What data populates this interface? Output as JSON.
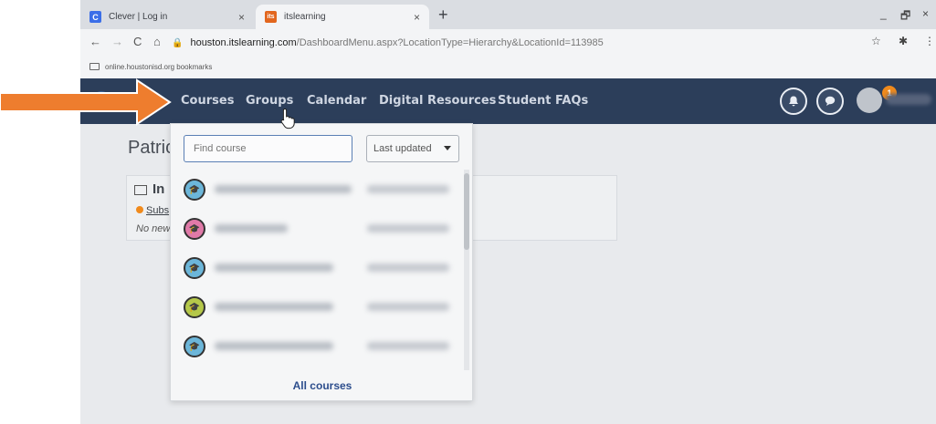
{
  "browser": {
    "tabs": [
      {
        "favicon": "C",
        "title": "Clever | Log in",
        "close": "×"
      },
      {
        "favicon": "its",
        "title": "itslearning",
        "close": "×"
      }
    ],
    "new_tab": "+",
    "window_controls": {
      "minimize": "_",
      "restore": "🗗",
      "close": "×"
    },
    "nav": {
      "back": "←",
      "forward": "→",
      "reload": "C",
      "home": "⌂"
    },
    "address": {
      "host": "houston.itslearning.com",
      "path": "/DashboardMenu.aspx?LocationType=Hierarchy&LocationId=113985"
    },
    "toolbar_icons": {
      "star": "☆",
      "extensions": "✱",
      "menu": "⋮"
    },
    "bookmarks_bar": {
      "folder": "online.houstonisd.org bookmarks"
    }
  },
  "itslearning_nav": {
    "links": [
      "Courses",
      "Groups",
      "Calendar",
      "Digital Resources",
      "Student FAQs"
    ],
    "notifications_count": "1",
    "bell_icon": "🔔",
    "messages_icon": "💬"
  },
  "page": {
    "title": "Patric",
    "card": {
      "title": "In",
      "subscribe_link": "Subs",
      "note": "No new"
    }
  },
  "courses_dropdown": {
    "search_placeholder": "Find course",
    "sort_value": "Last updated",
    "course_icon_colors": [
      "#6cb6d9",
      "#e07aa8",
      "#6cb6d9",
      "#b5c84a",
      "#6cb6d9"
    ],
    "all_courses_label": "All courses"
  },
  "annotation": {
    "arrow_color": "#ee7d2e"
  }
}
